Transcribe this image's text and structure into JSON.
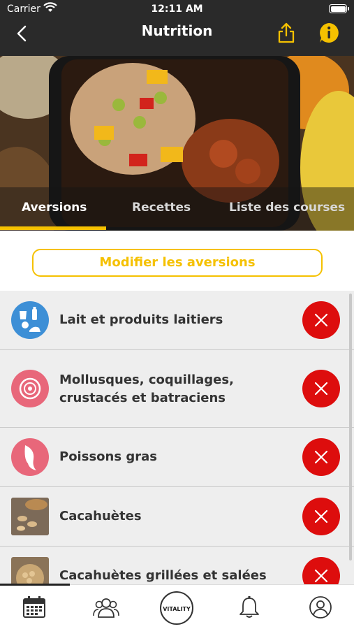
{
  "status_bar": {
    "carrier": "Carrier",
    "time": "12:11 AM"
  },
  "nav": {
    "title": "Nutrition",
    "icons": [
      "back-arrow-icon",
      "share-icon",
      "info-icon"
    ]
  },
  "tabs": [
    {
      "label": "Aversions",
      "active": true
    },
    {
      "label": "Recettes",
      "active": false
    },
    {
      "label": "Liste des courses",
      "active": false
    }
  ],
  "modify_button": {
    "label": "Modifier les aversions"
  },
  "aversions": [
    {
      "label": "Lait et produits laitiers",
      "icon": "dairy-icon"
    },
    {
      "label": "Mollusques, coquillages, crustacés et batraciens",
      "icon": "shell-icon"
    },
    {
      "label": "Poissons gras",
      "icon": "fish-icon"
    },
    {
      "label": "Cacahuètes",
      "icon": "peanuts-photo"
    },
    {
      "label": "Cacahuètes grillées et salées",
      "icon": "roasted-peanuts-photo"
    }
  ],
  "tab_bar": [
    {
      "icon": "calendar-icon"
    },
    {
      "icon": "community-icon"
    },
    {
      "icon": "vitality-logo",
      "text": "VITALITY"
    },
    {
      "icon": "bell-icon"
    },
    {
      "icon": "profile-icon"
    }
  ],
  "colors": {
    "accent": "#f5c100",
    "remove": "#dd0d0d",
    "header": "#2a2a2a",
    "dairy_icon": "#3d8fd6",
    "seafood_icon": "#e8677a"
  }
}
